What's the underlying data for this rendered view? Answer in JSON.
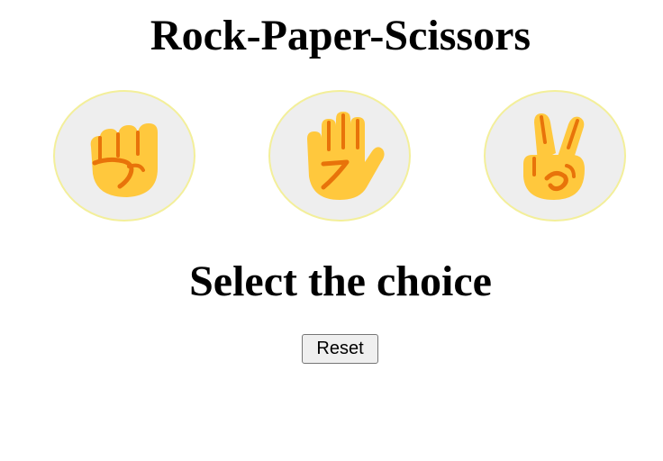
{
  "game": {
    "title": "Rock-Paper-Scissors",
    "message": "Select the choice",
    "reset_label": "Reset"
  },
  "choices": [
    {
      "id": "rock",
      "icon": "raised-fist-icon"
    },
    {
      "id": "paper",
      "icon": "raised-hand-icon"
    },
    {
      "id": "scissors",
      "icon": "victory-hand-icon"
    }
  ],
  "colors": {
    "circle_fill": "#eeeeee",
    "circle_border": "#f3ef9a",
    "hand_skin": "#ffc83d",
    "hand_shadow": "#e8730a",
    "button_bg": "#efefef"
  }
}
